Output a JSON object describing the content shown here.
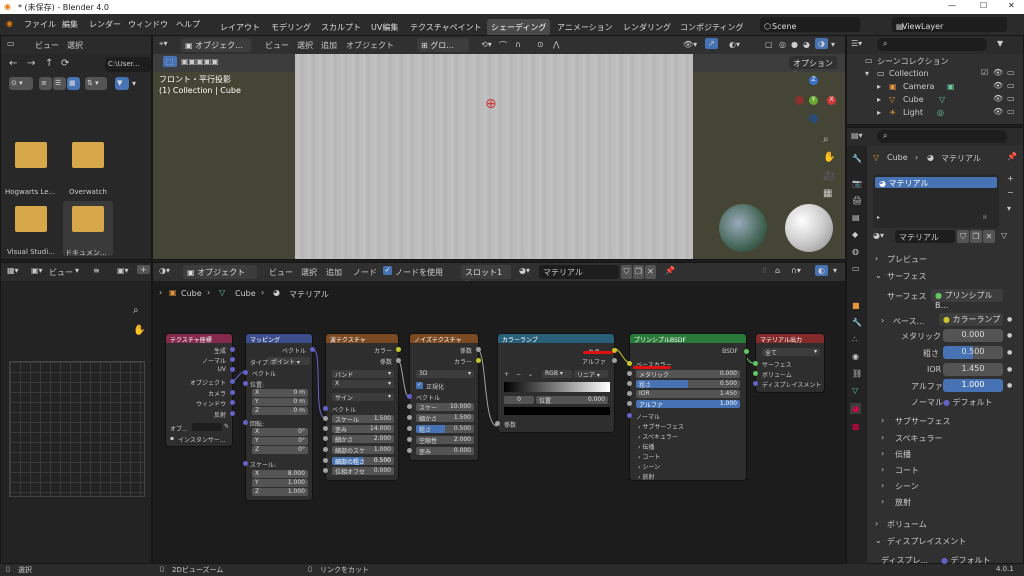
{
  "title": "* (未保存) - Blender 4.0",
  "menu": [
    "ファイル",
    "編集",
    "レンダー",
    "ウィンドウ",
    "ヘルプ"
  ],
  "workspaces": [
    "レイアウト",
    "モデリング",
    "スカルプト",
    "UV編集",
    "テクスチャペイント",
    "シェーディング",
    "アニメーション",
    "レンダリング",
    "コンポジティング"
  ],
  "scene": "Scene",
  "viewlayer": "ViewLayer",
  "filebrowser": {
    "menus": [
      "ビュー",
      "選択"
    ],
    "path": "C:\\User...",
    "items": [
      "Hogwarts Le...",
      "Overwatch",
      "Visual Studi...",
      "ドキュメン..."
    ]
  },
  "viewport": {
    "mode": "オブジェク...",
    "menus": [
      "ビュー",
      "選択",
      "追加",
      "オブジェクト"
    ],
    "shading": "グロ...",
    "options": "オプション",
    "label1": "フロント・平行投影",
    "label2": "(1) Collection | Cube"
  },
  "outliner": {
    "root": "シーンコレクション",
    "collection": "Collection",
    "items": [
      "Camera",
      "Cube",
      "Light"
    ]
  },
  "node_editor": {
    "mode": "オブジェクト",
    "menus": [
      "ビュー",
      "選択",
      "追加",
      "ノード"
    ],
    "use_nodes": "ノードを使用",
    "slot": "スロット1",
    "material": "マテリアル",
    "breadcrumb": [
      "Cube",
      "Cube",
      "マテリアル"
    ],
    "left_menus": [
      "ビュー"
    ]
  },
  "nodes": {
    "texcoord": {
      "title": "テクスチャ座標",
      "outs": [
        "生成",
        "ノーマル",
        "UV",
        "オブジェクト",
        "カメラ",
        "ウィンドウ",
        "反射"
      ],
      "obj": "オブ...",
      "inst": "インスタンサー..."
    },
    "mapping": {
      "title": "マッピング",
      "out": "ベクトル",
      "type_label": "タイプ:",
      "type": "ポイント",
      "vec": "ベクトル",
      "loc": "位置:",
      "rot": "回転:",
      "scale": "スケール:",
      "x": "X",
      "y": "Y",
      "z": "Z",
      "lx": "0 m",
      "ly": "0 m",
      "lz": "0 m",
      "rx": "0°",
      "ry": "0°",
      "rz": "0°",
      "sx": "8.000",
      "sy": "1.000",
      "sz": "1.000"
    },
    "wave": {
      "title": "波テクスチャ",
      "outs": [
        "カラー",
        "係数"
      ],
      "type": "バンド",
      "axis": "X",
      "profile": "サイン",
      "vec": "ベクトル",
      "scale_l": "スケール",
      "scale": "1.500",
      "dist_l": "歪み",
      "dist": "14.000",
      "detail_l": "細かさ",
      "detail": "2.000",
      "dscale_l": "細部のスケ",
      "dscale": "1.000",
      "drough_l": "細部の粗さ",
      "drough": "0.500",
      "phase_l": "位相オフセ",
      "phase": "0.000"
    },
    "noise": {
      "title": "ノイズテクスチャ",
      "outs": [
        "係数",
        "カラー"
      ],
      "dim": "3D",
      "norm": "正規化",
      "vec": "ベクトル",
      "scale_l": "スケー",
      "scale": "10.000",
      "detail_l": "細かさ",
      "detail": "1.500",
      "rough_l": "粗さ",
      "rough": "0.500",
      "lac_l": "空隙性",
      "lac": "2.000",
      "dist_l": "歪み",
      "dist": "0.000"
    },
    "ramp": {
      "title": "カラーランプ",
      "outs": [
        "カラー",
        "アルファ"
      ],
      "mode": "RGB",
      "interp": "リニア",
      "idx": "0",
      "pos_l": "位置",
      "pos": "0.000",
      "in": "係数"
    },
    "bsdf": {
      "title": "プリンシプルBSDF",
      "out": "BSDF",
      "base": "ベースカラー",
      "metal_l": "メタリック",
      "metal": "0.000",
      "rough_l": "粗さ",
      "rough": "0.500",
      "ior_l": "IOR",
      "ior": "1.450",
      "alpha_l": "アルファ",
      "alpha": "1.000",
      "normal": "ノーマル",
      "subs": [
        "サブサーフェス",
        "スペキュラー",
        "伝播",
        "コート",
        "シーン",
        "放射"
      ]
    },
    "output": {
      "title": "マテリアル出力",
      "sel": "全て",
      "ins": [
        "サーフェス",
        "ボリューム",
        "ディスプレイスメント"
      ]
    }
  },
  "properties": {
    "obj": "Cube",
    "mat": "マテリアル",
    "slot": "マテリアル",
    "mat_field": "マテリアル",
    "preview": "プレビュー",
    "surface_panel": "サーフェス",
    "surface_l": "サーフェス",
    "surface": "プリンシプルB...",
    "base_l": "ベース...",
    "base": "カラーランプ",
    "metal_l": "メタリック",
    "metal": "0.000",
    "rough_l": "粗さ",
    "rough": "0.500",
    "ior_l": "IOR",
    "ior": "1.450",
    "alpha_l": "アルファ",
    "alpha": "1.000",
    "normal_l": "ノーマル",
    "normal": "デフォルト",
    "subs": [
      "サブサーフェス",
      "スペキュラー",
      "伝播",
      "コート",
      "シーン",
      "放射"
    ],
    "volume": "ボリューム",
    "disp": "ディスプレイスメント",
    "disp_l": "ディスプレ...",
    "disp_v": "デフォルト"
  },
  "status": {
    "left": "選択",
    "mid": "2Dビューズーム",
    "right": "リンクをカット",
    "version": "4.0.1"
  }
}
